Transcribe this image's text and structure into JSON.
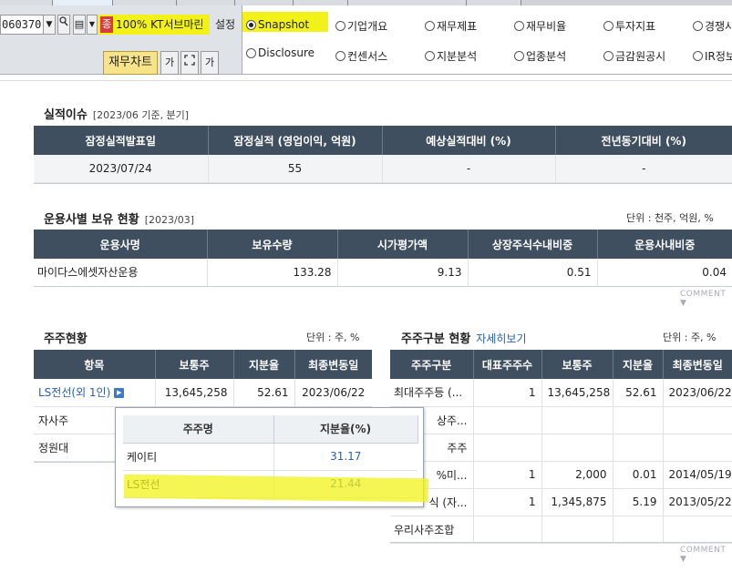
{
  "toolbar": {
    "code": "060370",
    "jong_badge": "종",
    "stock_name": "100% KT서브마린",
    "setting_label": "설정",
    "financial_chart_label": "재무차트",
    "font_btn_1": "가",
    "font_btn_2": "가"
  },
  "radio_options": [
    {
      "label": "Snapshot",
      "selected": true
    },
    {
      "label": "기업개요",
      "selected": false
    },
    {
      "label": "재무제표",
      "selected": false
    },
    {
      "label": "재무비율",
      "selected": false
    },
    {
      "label": "투자지표",
      "selected": false
    },
    {
      "label": "경쟁사",
      "selected": false
    },
    {
      "label": "Disclosure",
      "selected": false
    },
    {
      "label": "컨센서스",
      "selected": false
    },
    {
      "label": "지분분석",
      "selected": false
    },
    {
      "label": "업종분석",
      "selected": false
    },
    {
      "label": "금감원공시",
      "selected": false
    },
    {
      "label": "IR정보",
      "selected": false
    }
  ],
  "earnings": {
    "title": "실적이슈",
    "subtitle": "[2023/06 기준, 분기]",
    "headers": [
      "잠정실적발표일",
      "잠정실적 (영업이익, 억원)",
      "예상실적대비 (%)",
      "전년동기대비 (%)"
    ],
    "row": [
      "2023/07/24",
      "55",
      "-",
      "-"
    ]
  },
  "fund_holdings": {
    "title": "운용사별 보유 현황",
    "subtitle": "[2023/03]",
    "unit": "단위 : 천주, 억원, %",
    "headers": [
      "운용사명",
      "보유수량",
      "시가평가액",
      "상장주식수내비중",
      "운용사내비중"
    ],
    "row": [
      "마이다스에셋자산운용",
      "133.28",
      "9.13",
      "0.51",
      "0.04"
    ],
    "comment": "COMMENT ▼"
  },
  "shareholders": {
    "title": "주주현황",
    "unit": "단위 : 주, %",
    "headers": [
      "항목",
      "보통주",
      "지분율",
      "최종변동일"
    ],
    "rows": [
      {
        "name": "LS전선(외 1인)",
        "shares": "13,645,258",
        "pct": "52.61",
        "date": "2023/06/22"
      },
      {
        "name": "자사주",
        "shares": "",
        "pct": "",
        "date": ""
      },
      {
        "name": "정원대",
        "shares": "",
        "pct": "",
        "date": ""
      }
    ]
  },
  "popup": {
    "headers": [
      "주주명",
      "지분율(%)"
    ],
    "rows": [
      {
        "name": "케이티",
        "pct": "31.17"
      },
      {
        "name": "LS전선",
        "pct": "21.44"
      }
    ]
  },
  "holder_types": {
    "title": "주주구분 현황",
    "detail_link": "자세히보기",
    "unit": "단위 : 주, %",
    "headers": [
      "주주구분",
      "대표주주수",
      "보통주",
      "지분율",
      "최종변동일"
    ],
    "rows": [
      {
        "type": "최대주주등 (...",
        "count": "1",
        "shares": "13,645,258",
        "pct": "52.61",
        "date": "2023/06/22"
      },
      {
        "type": "상주...",
        "count": "",
        "shares": "",
        "pct": "",
        "date": ""
      },
      {
        "type": "주주",
        "count": "",
        "shares": "",
        "pct": "",
        "date": ""
      },
      {
        "type": "%미...",
        "count": "1",
        "shares": "2,000",
        "pct": "0.01",
        "date": "2014/05/19"
      },
      {
        "type": "식 (자...",
        "count": "1",
        "shares": "1,345,875",
        "pct": "5.19",
        "date": "2013/05/22"
      },
      {
        "type": "우리사주조합",
        "count": "",
        "shares": "",
        "pct": "",
        "date": ""
      }
    ],
    "comment": "COMMENT ▼"
  }
}
